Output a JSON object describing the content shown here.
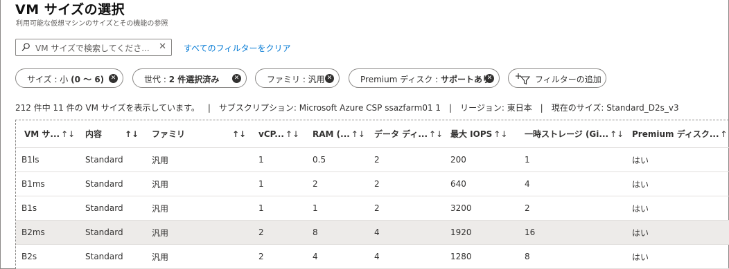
{
  "page": {
    "title": "VM サイズの選択",
    "subtitle": "利用可能な仮想マシンのサイズとその機能の参照"
  },
  "search": {
    "placeholder": "VM サイズで検索してくださ...",
    "icon": "search-icon",
    "clear_glyph": "✕"
  },
  "clear_filters_link": "すべてのフィルターをクリア",
  "filters": [
    {
      "label": "サイズ : 小 ",
      "value": "(0 〜 6)"
    },
    {
      "label": "世代 : ",
      "value": "2 件選択済み"
    },
    {
      "label": "ファミリ : 汎用",
      "value": ""
    },
    {
      "label": "Premium ディスク : ",
      "value": "サポートあり"
    }
  ],
  "add_filter_label": "フィルターの追加",
  "summary": {
    "count": "212 件中 11 件の VM サイズを表示しています。",
    "subscription": "サブスクリプション: Microsoft Azure CSP ssazfarm01 1",
    "region": "リージョン: 東日本",
    "current_size": "現在のサイズ: Standard_D2s_v3"
  },
  "sort_glyph": "↑↓",
  "table": {
    "columns": [
      "VM サ...",
      "内容",
      "ファミリ",
      "vCP...",
      "RAM (...",
      "データ ディ...",
      "最大 IOPS",
      "一時ストレージ (Gi...",
      "Premium ディスク..."
    ],
    "rows": [
      [
        "B1ls",
        "Standard",
        "汎用",
        "1",
        "0.5",
        "2",
        "200",
        "1",
        "はい"
      ],
      [
        "B1ms",
        "Standard",
        "汎用",
        "1",
        "2",
        "2",
        "640",
        "4",
        "はい"
      ],
      [
        "B1s",
        "Standard",
        "汎用",
        "1",
        "1",
        "2",
        "3200",
        "2",
        "はい"
      ],
      [
        "B2ms",
        "Standard",
        "汎用",
        "2",
        "8",
        "4",
        "1920",
        "16",
        "はい"
      ],
      [
        "B2s",
        "Standard",
        "汎用",
        "2",
        "4",
        "4",
        "1280",
        "8",
        "はい"
      ]
    ],
    "selected_row": 3
  },
  "colors": {
    "link": "#0078d4",
    "selected_row_bg": "#edebe9",
    "border": "#8a8886"
  }
}
